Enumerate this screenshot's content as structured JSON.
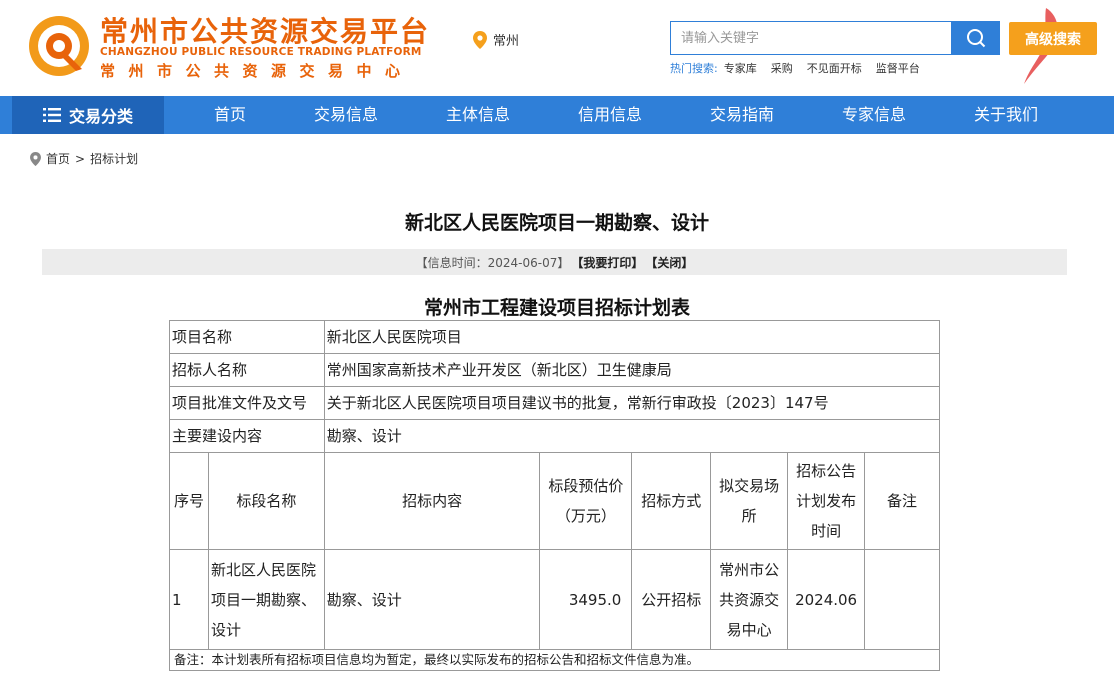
{
  "header": {
    "logo_cn": "常州市公共资源交易平台",
    "logo_en": "CHANGZHOU PUBLIC RESOURCE TRADING PLATFORM",
    "logo_sub": "常州市公共资源交易中心",
    "location": "常州",
    "search_placeholder": "请输入关键字",
    "advanced_search": "高级搜索",
    "hot_label": "热门搜索:",
    "hot_links": [
      "专家库",
      "采购",
      "不见面开标",
      "监督平台"
    ]
  },
  "nav": {
    "category": "交易分类",
    "items": [
      "首页",
      "交易信息",
      "主体信息",
      "信用信息",
      "交易指南",
      "专家信息",
      "关于我们"
    ]
  },
  "breadcrumb": {
    "home": "首页",
    "sep": ">",
    "current": "招标计划"
  },
  "article": {
    "title": "新北区人民医院项目一期勘察、设计",
    "info_time": "【信息时间：2024-06-07】",
    "print": "【我要打印】",
    "close": "【关闭】",
    "table_title": "常州市工程建设项目招标计划表"
  },
  "table": {
    "project_name_label": "项目名称",
    "project_name": "新北区人民医院项目",
    "tenderer_label": "招标人名称",
    "tenderer": "常州国家高新技术产业开发区（新北区）卫生健康局",
    "approval_label": "项目批准文件及文号",
    "approval": "关于新北区人民医院项目项目建议书的批复，常新行审政投〔2023〕147号",
    "content_label": "主要建设内容",
    "content": "勘察、设计",
    "headers": {
      "seq": "序号",
      "section_name": "标段名称",
      "tender_content": "招标内容",
      "estimate": "标段预估价（万元）",
      "method": "招标方式",
      "venue": "拟交易场所",
      "publish_time": "招标公告计划发布时间",
      "remark": "备注"
    },
    "row": {
      "seq": "1",
      "section_name": "新北区人民医院项目一期勘察、设计",
      "tender_content": "勘察、设计",
      "estimate": "3495.0",
      "method": "公开招标",
      "venue": "常州市公共资源交易中心",
      "publish_time": "2024.06",
      "remark": ""
    },
    "note": "备注：本计划表所有招标项目信息均为暂定，最终以实际发布的招标公告和招标文件信息为准。"
  },
  "colors": {
    "brand_orange": "#e8630a",
    "nav_blue": "#2f7fd8",
    "nav_dark": "#1f64b8",
    "advanced_btn": "#f5a01c"
  }
}
